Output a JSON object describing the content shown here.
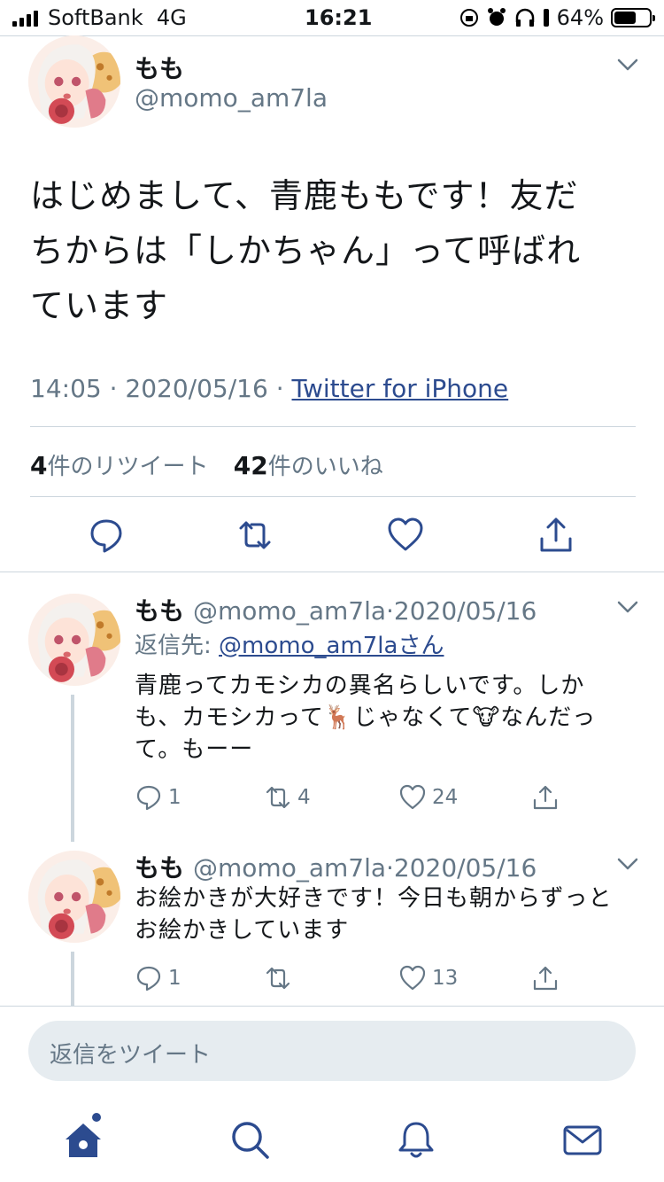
{
  "status_bar": {
    "carrier": "SoftBank",
    "network": "4G",
    "time": "16:21",
    "battery": "64%",
    "battery_level": 0.64
  },
  "main_tweet": {
    "name": "もも",
    "handle": "@momo_am7la",
    "text_lines": [
      "はじめまして、青鹿ももです！友だ",
      "ちからは「しかちゃん」って呼ばれ",
      "ています"
    ],
    "time": "14:05",
    "date": "2020/05/16",
    "source": "Twitter for iPhone",
    "retweet_count": "4",
    "retweet_label": "件のリツイート",
    "like_count": "42",
    "like_label": "件のいいね"
  },
  "replies": [
    {
      "name": "もも",
      "handle": "@momo_am7la",
      "date": "2020/05/16",
      "reply_to_label": "返信先:",
      "reply_to_handle": "@momo_am7laさん",
      "text_lines": [
        "青鹿ってカモシカの異名らしいです。しか",
        "も、カモシカって🦌じゃなくて🐮なんだっ",
        "て。もーー"
      ],
      "replies": "1",
      "retweets": "4",
      "likes": "24"
    },
    {
      "name": "もも",
      "handle": "@momo_am7la",
      "date": "2020/05/16",
      "text_lines": [
        "お絵かきが大好きです！今日も朝からずっと",
        "お絵かきしています"
      ],
      "replies": "1",
      "retweets": "",
      "likes": "13"
    }
  ],
  "composer": {
    "placeholder": "返信をツイート"
  },
  "icons": {
    "actions": [
      "reply-icon",
      "retweet-icon",
      "like-icon",
      "share-icon"
    ],
    "tabs": [
      "home-icon",
      "search-icon",
      "notifications-icon",
      "messages-icon"
    ]
  },
  "colors": {
    "accent": "#2c4b8f",
    "secondary_text": "#657786",
    "border": "#ccd6dd",
    "composer_bg": "#e6ecf0"
  }
}
